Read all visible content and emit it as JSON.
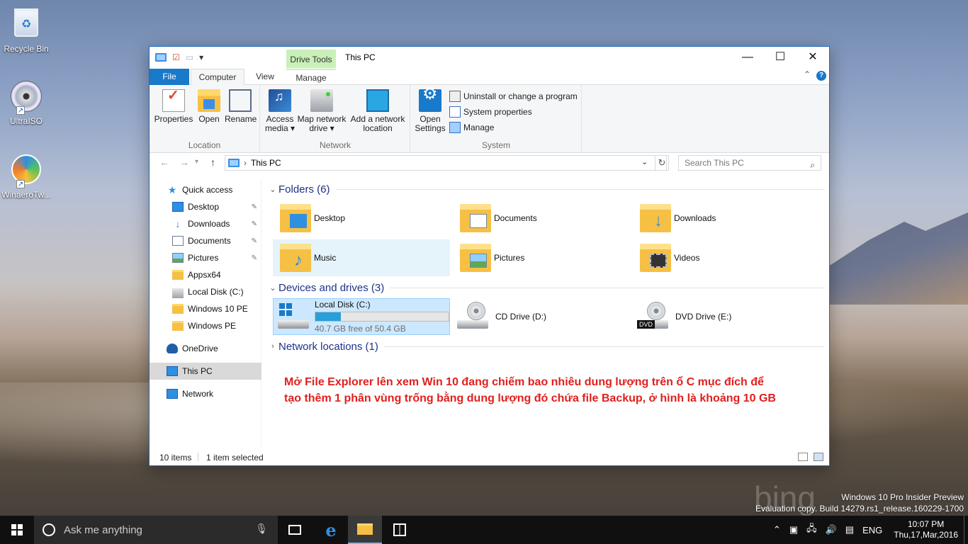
{
  "desktop": {
    "icons": [
      {
        "label": "Recycle Bin",
        "icon": "recycle-bin-icon"
      },
      {
        "label": "UltraISO",
        "icon": "disc-icon"
      },
      {
        "label": "WinaeroTw...",
        "icon": "winaero-icon"
      }
    ],
    "watermark": {
      "line1": "Windows 10 Pro Insider Preview",
      "line2": "Evaluation copy. Build 14279.rs1_release.160229-1700"
    },
    "bing": "bing"
  },
  "window": {
    "title": "This PC",
    "contextual_tab": "Drive Tools",
    "controls": {
      "minimize": "—",
      "maximize": "☐",
      "close": "✕"
    },
    "tabs": {
      "file": "File",
      "computer": "Computer",
      "view": "View",
      "manage": "Manage"
    },
    "ribbon": {
      "location_group": "Location",
      "network_group": "Network",
      "system_group": "System",
      "properties": "Properties",
      "open": "Open",
      "rename": "Rename",
      "access_media_1": "Access",
      "access_media_2": "media ▾",
      "map_drive_1": "Map network",
      "map_drive_2": "drive ▾",
      "add_location_1": "Add a network",
      "add_location_2": "location",
      "open_settings_1": "Open",
      "open_settings_2": "Settings",
      "uninstall": "Uninstall or change a program",
      "system_properties": "System properties",
      "manage": "Manage"
    },
    "address": {
      "path": "This PC",
      "search_placeholder": "Search This PC"
    },
    "navpane": {
      "quick_access": "Quick access",
      "items": [
        "Desktop",
        "Downloads",
        "Documents",
        "Pictures",
        "Appsx64",
        "Local Disk (C:)",
        "Windows 10 PE",
        "Windows PE"
      ],
      "onedrive": "OneDrive",
      "this_pc": "This PC",
      "network": "Network"
    },
    "folders": {
      "header": "Folders (6)",
      "items": [
        "Desktop",
        "Documents",
        "Downloads",
        "Music",
        "Pictures",
        "Videos"
      ]
    },
    "devices": {
      "header": "Devices and drives (3)",
      "local_disk": {
        "name": "Local Disk (C:)",
        "free": "40.7 GB free of 50.4 GB",
        "used_fraction": 0.19
      },
      "cd": "CD Drive (D:)",
      "dvd": "DVD Drive (E:)",
      "dvd_badge": "DVD"
    },
    "network_locations": {
      "header": "Network locations (1)"
    },
    "note_line1": "Mở File Explorer lên xem Win 10 đang chiếm bao nhiêu dung lượng trên ổ C mục đích để",
    "note_line2": "tạo thêm 1 phân vùng trống bằng dung lượng đó chứa file Backup, ở hình là khoảng 10 GB",
    "status": {
      "items": "10 items",
      "selected": "1 item selected"
    }
  },
  "taskbar": {
    "search_text": "Ask me anything",
    "language": "ENG",
    "time": "10:07 PM",
    "date": "Thu,17,Mar,2016"
  },
  "colors": {
    "accent": "#1979ca",
    "note": "#e0201d",
    "drive_tools": "#c9f0b8"
  }
}
